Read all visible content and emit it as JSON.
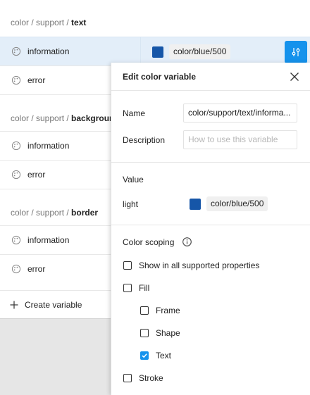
{
  "groups": [
    {
      "path": "color / support / ",
      "leaf": "text",
      "rows": [
        "information",
        "error"
      ]
    },
    {
      "path": "color / support / ",
      "leaf": "background",
      "rows": [
        "information",
        "error"
      ]
    },
    {
      "path": "color / support / ",
      "leaf": "border",
      "rows": [
        "information",
        "error"
      ]
    }
  ],
  "selected_row": {
    "value_chip": "color/blue/500",
    "swatch_color": "#1656a8"
  },
  "create_label": "Create variable",
  "panel": {
    "title": "Edit color variable",
    "name_label": "Name",
    "name_value": "color/support/text/informa...",
    "description_label": "Description",
    "description_placeholder": "How to use this variable",
    "value_title": "Value",
    "mode_label": "light",
    "mode_value": "color/blue/500",
    "scoping_title": "Color scoping",
    "options": [
      {
        "label": "Show in all supported properties",
        "checked": false,
        "indent": false
      },
      {
        "label": "Fill",
        "checked": false,
        "indent": false
      },
      {
        "label": "Frame",
        "checked": false,
        "indent": true
      },
      {
        "label": "Shape",
        "checked": false,
        "indent": true
      },
      {
        "label": "Text",
        "checked": true,
        "indent": true
      },
      {
        "label": "Stroke",
        "checked": false,
        "indent": false
      }
    ]
  },
  "colors": {
    "accent": "#1592ec",
    "swatch": "#1656a8",
    "selected_bg": "#e3eef9"
  }
}
